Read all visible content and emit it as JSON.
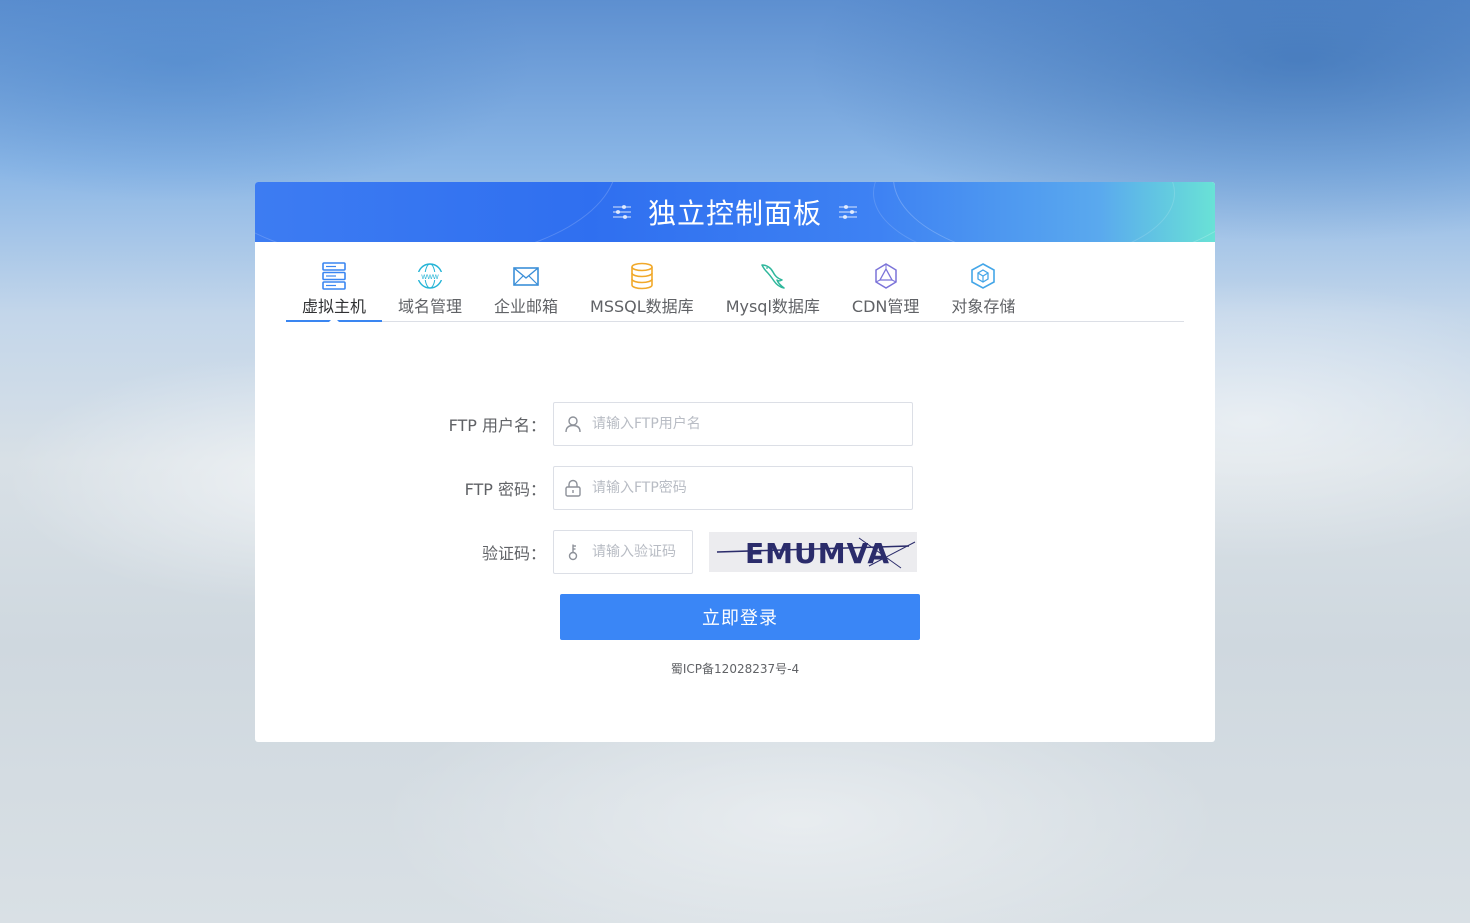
{
  "header": {
    "title": "独立控制面板",
    "left_icon": "sliders-icon",
    "right_icon": "sliders-icon"
  },
  "tabs": [
    {
      "label": "虚拟主机",
      "icon": "server-icon",
      "color": "#3a86f1",
      "active": true
    },
    {
      "label": "域名管理",
      "icon": "www-icon",
      "color": "#25b4d6",
      "active": false
    },
    {
      "label": "企业邮箱",
      "icon": "mail-icon",
      "color": "#3b8fd8",
      "active": false
    },
    {
      "label": "MSSQL数据库",
      "icon": "database-icon",
      "color": "#f1a92b",
      "active": false
    },
    {
      "label": "Mysql数据库",
      "icon": "dolphin-icon",
      "color": "#2fb79c",
      "active": false
    },
    {
      "label": "CDN管理",
      "icon": "cdn-network-icon",
      "color": "#7b73d9",
      "active": false
    },
    {
      "label": "对象存储",
      "icon": "cube-icon",
      "color": "#44a6e8",
      "active": false
    }
  ],
  "form": {
    "username_label": "FTP 用户名：",
    "username_placeholder": "请输入FTP用户名",
    "username_value": "",
    "password_label": "FTP 密码：",
    "password_placeholder": "请输入FTP密码",
    "password_value": "",
    "captcha_label": "验证码：",
    "captcha_placeholder": "请输入验证码",
    "captcha_value": "",
    "captcha_text": "EMUMVA",
    "submit_label": "立即登录"
  },
  "footer": {
    "icp": "蜀ICP备12028237号-4"
  },
  "colors": {
    "accent": "#3a86f6",
    "header_start": "#3d7cf2",
    "header_end": "#69e2d6"
  }
}
